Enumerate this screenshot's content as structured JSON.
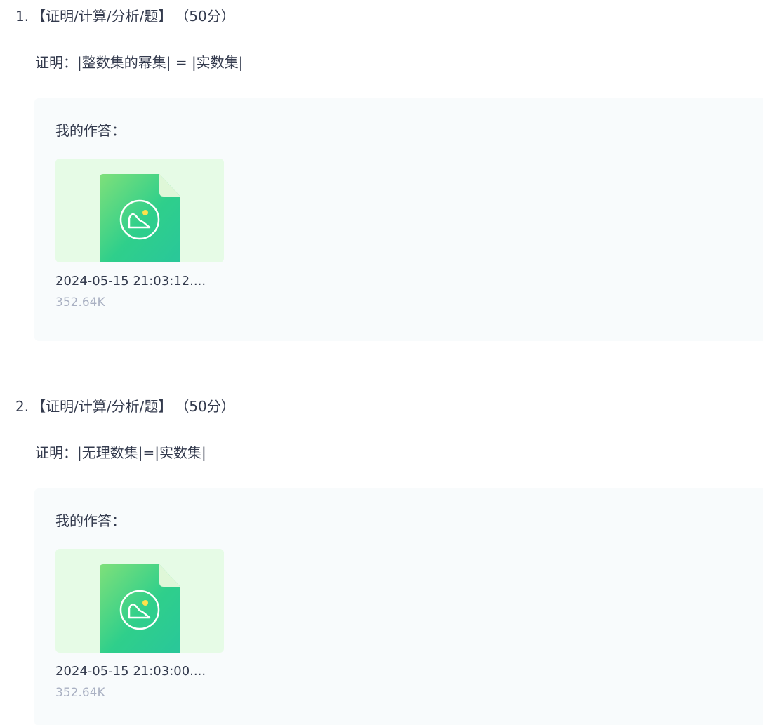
{
  "questions": [
    {
      "number": "1.",
      "type": "【证明/计算/分析/题】",
      "score": "（50分）",
      "stem": "证明：|整数集的幂集| = |实数集|",
      "answer_label": "我的作答：",
      "attachment": {
        "icon": "image-file-icon",
        "file_name": "2024-05-15 21:03:12....",
        "file_size": "352.64K"
      }
    },
    {
      "number": "2.",
      "type": "【证明/计算/分析/题】",
      "score": "（50分）",
      "stem": "证明：|无理数集|=|实数集|",
      "answer_label": "我的作答：",
      "attachment": {
        "icon": "image-file-icon",
        "file_name": "2024-05-15 21:03:00....",
        "file_size": "352.64K"
      }
    }
  ],
  "colors": {
    "text": "#333a4d",
    "muted": "#a9b0c2",
    "answer_bg": "#f8fbfc",
    "thumb_bg": "#e6fbe6",
    "file_icon_green": "#2ecf8e"
  }
}
